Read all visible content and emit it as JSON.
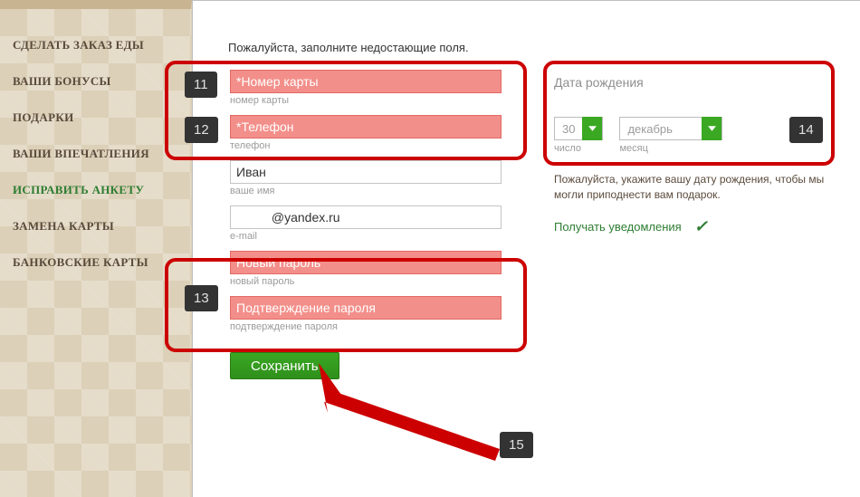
{
  "sidebar": {
    "items": [
      {
        "label": "Сделать заказ еды"
      },
      {
        "label": "Ваши бонусы"
      },
      {
        "label": "Подарки"
      },
      {
        "label": "Ваши впечатления"
      },
      {
        "label": "Исправить анкету"
      },
      {
        "label": "Замена карты"
      },
      {
        "label": "Банковские карты"
      }
    ]
  },
  "form": {
    "instruction": "Пожалуйста, заполните недостающие поля.",
    "cardNumber": {
      "placeholder": "*Номер карты",
      "hint": "номер карты"
    },
    "phone": {
      "placeholder": "*Телефон",
      "hint": "телефон"
    },
    "name": {
      "value": "Иван",
      "hint": "ваше имя"
    },
    "email": {
      "value": "          @yandex.ru",
      "hint": "e-mail"
    },
    "newPassword": {
      "placeholder": "Новый пароль",
      "hint": "новый пароль"
    },
    "confirmPassword": {
      "placeholder": "Подтверждение пароля",
      "hint": "подтверждение пароля"
    },
    "save": "Сохранить"
  },
  "dob": {
    "title": "Дата рождения",
    "day": {
      "value": "30",
      "hint": "число"
    },
    "month": {
      "value": "декабрь",
      "hint": "месяц"
    },
    "note": "Пожалуйста, укажите вашу дату рождения, чтобы мы могли приподнести вам подарок.",
    "notify": "Получать уведомления"
  },
  "annotations": {
    "a11": "11",
    "a12": "12",
    "a13": "13",
    "a14": "14",
    "a15": "15"
  }
}
